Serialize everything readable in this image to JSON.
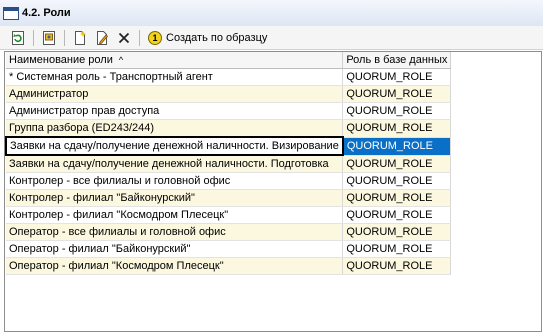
{
  "window": {
    "title": "4.2. Роли"
  },
  "toolbar": {
    "create_by_template_label": "Создать по образцу",
    "create_by_template_number": "1"
  },
  "grid": {
    "columns": [
      {
        "label": "Наименование роли",
        "sort": "^"
      },
      {
        "label": "Роль в базе данных"
      }
    ],
    "rows": [
      {
        "name": "* Системная роль - Транспортный агент",
        "db_role": "QUORUM_ROLE"
      },
      {
        "name": "Администратор",
        "db_role": "QUORUM_ROLE"
      },
      {
        "name": "Администратор прав доступа",
        "db_role": "QUORUM_ROLE"
      },
      {
        "name": "Группа разбора (ED243/244)",
        "db_role": "QUORUM_ROLE"
      },
      {
        "name": "Заявки на сдачу/получение денежной наличности. Визирование",
        "db_role": "QUORUM_ROLE"
      },
      {
        "name": "Заявки на сдачу/получение денежной наличности. Подготовка",
        "db_role": "QUORUM_ROLE"
      },
      {
        "name": "Контролер - все филиалы и головной офис",
        "db_role": "QUORUM_ROLE"
      },
      {
        "name": "Контролер - филиал \"Байконурский\"",
        "db_role": "QUORUM_ROLE"
      },
      {
        "name": "Контролер - филиал \"Космодром Плесецк\"",
        "db_role": "QUORUM_ROLE"
      },
      {
        "name": "Оператор - все филиалы и головной офис",
        "db_role": "QUORUM_ROLE"
      },
      {
        "name": "Оператор - филиал \"Байконурский\"",
        "db_role": "QUORUM_ROLE"
      },
      {
        "name": "Оператор - филиал \"Космодром Плесецк\"",
        "db_role": "QUORUM_ROLE"
      }
    ]
  },
  "colors": {
    "selected_row": "#0a70c7",
    "alt_row": "#fbf8df"
  },
  "icons": [
    "window-icon",
    "refresh-icon",
    "properties-icon",
    "new-icon",
    "edit-icon",
    "delete-icon"
  ]
}
